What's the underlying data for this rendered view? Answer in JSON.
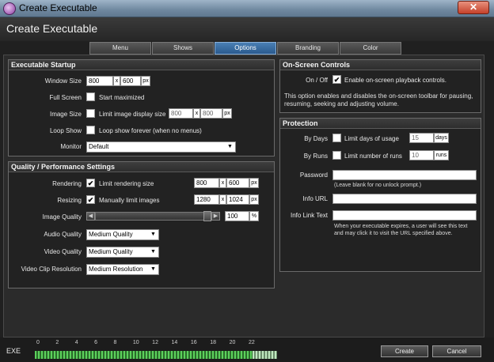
{
  "window": {
    "title": "Create Executable",
    "close_glyph": "✕"
  },
  "dialog": {
    "title": "Create Executable"
  },
  "tabs": [
    {
      "label": "Menu"
    },
    {
      "label": "Shows"
    },
    {
      "label": "Options"
    },
    {
      "label": "Branding"
    },
    {
      "label": "Color"
    }
  ],
  "active_tab": "Options",
  "startup": {
    "title": "Executable Startup",
    "window_size": {
      "label": "Window Size",
      "width": "800",
      "x": "x",
      "height": "600",
      "unit": "px"
    },
    "full_screen": {
      "label": "Full Screen",
      "checked": false,
      "text": "Start maximized"
    },
    "image_size": {
      "label": "Image Size",
      "checked": false,
      "text": "Limit image display size",
      "width": "800",
      "x": "x",
      "height": "800",
      "unit": "px"
    },
    "loop_show": {
      "label": "Loop Show",
      "checked": false,
      "text": "Loop show forever (when no menus)"
    },
    "monitor": {
      "label": "Monitor",
      "value": "Default"
    }
  },
  "quality": {
    "title": "Quality / Performance Settings",
    "rendering": {
      "label": "Rendering",
      "checked": true,
      "text": "Limit rendering size",
      "width": "800",
      "x": "x",
      "height": "600",
      "unit": "px"
    },
    "resizing": {
      "label": "Resizing",
      "checked": true,
      "text": "Manually limit images",
      "width": "1280",
      "x": "x",
      "height": "1024",
      "unit": "px"
    },
    "image_quality": {
      "label": "Image Quality",
      "value": "100",
      "unit": "%",
      "level": 1.0
    },
    "audio_quality": {
      "label": "Audio Quality",
      "value": "Medium Quality"
    },
    "video_quality": {
      "label": "Video Quality",
      "value": "Medium Quality"
    },
    "video_clip_resolution": {
      "label": "Video Clip Resolution",
      "value": "Medium Resolution"
    }
  },
  "onscreen": {
    "title": "On-Screen Controls",
    "toggle_label": "On / Off",
    "checked": true,
    "text": "Enable on-screen playback controls.",
    "description": "This option enables and disables the on-screen toolbar for pausing, resuming, seeking and adjusting volume."
  },
  "protection": {
    "title": "Protection",
    "by_days": {
      "label": "By Days",
      "checked": false,
      "text": "Limit days of usage",
      "value": "15",
      "unit": "days"
    },
    "by_runs": {
      "label": "By Runs",
      "checked": false,
      "text": "Limit number of runs",
      "value": "10",
      "unit": "runs"
    },
    "password": {
      "label": "Password",
      "value": "",
      "note": "(Leave blank for no unlock prompt.)"
    },
    "info_url": {
      "label": "Info URL",
      "value": ""
    },
    "info_link_text": {
      "label": "Info Link Text",
      "value": ""
    },
    "expiry_note": "When your executable expires, a user will see this text and may click it to visit the URL specified above."
  },
  "footer": {
    "label": "EXE",
    "meter_ticks": [
      "0",
      "2",
      "4",
      "6",
      "8",
      "10",
      "12",
      "14",
      "16",
      "18",
      "20",
      "22"
    ],
    "meter_level": 0.9,
    "create_label": "Create",
    "cancel_label": "Cancel"
  }
}
